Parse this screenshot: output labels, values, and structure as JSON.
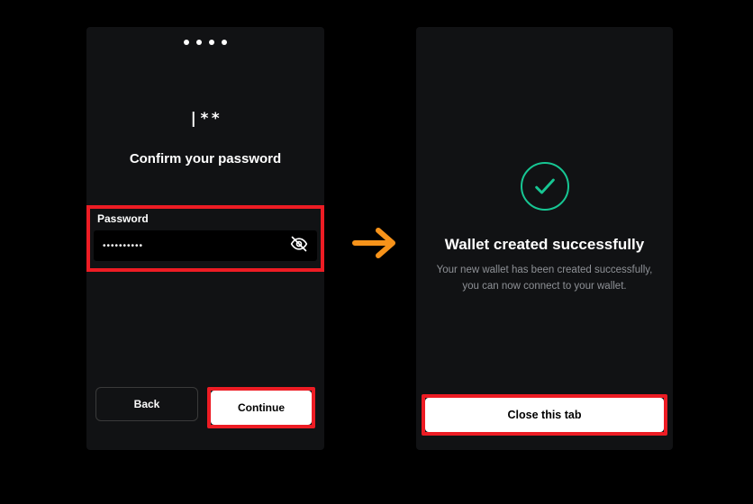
{
  "left": {
    "stepper_count": 4,
    "lock_glyph": "|**",
    "title": "Confirm your password",
    "field_label": "Password",
    "field_value": "••••••••••",
    "back_label": "Back",
    "continue_label": "Continue"
  },
  "right": {
    "title": "Wallet created successfully",
    "desc": "Your new wallet has been created successfully, you can now connect to your wallet.",
    "close_label": "Close this tab"
  },
  "colors": {
    "highlight": "#ed1c24",
    "success": "#17c693",
    "arrow": "#f7931a"
  }
}
